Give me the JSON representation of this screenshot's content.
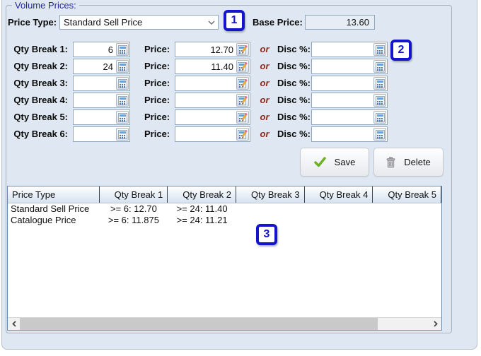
{
  "group": {
    "title": "Volume Prices:"
  },
  "header": {
    "price_type_label": "Price Type:",
    "price_type_value": "Standard Sell Price",
    "base_price_label": "Base Price:",
    "base_price_value": "13.60"
  },
  "callouts": {
    "one": "1",
    "two": "2",
    "three": "3"
  },
  "form": {
    "price_label": "Price:",
    "or_label": "or",
    "disc_label": "Disc %:",
    "rows": [
      {
        "label": "Qty Break 1:",
        "qty": "6",
        "price": "12.70",
        "disc": ""
      },
      {
        "label": "Qty Break 2:",
        "qty": "24",
        "price": "11.40",
        "disc": ""
      },
      {
        "label": "Qty Break 3:",
        "qty": "",
        "price": "",
        "disc": ""
      },
      {
        "label": "Qty Break 4:",
        "qty": "",
        "price": "",
        "disc": ""
      },
      {
        "label": "Qty Break 5:",
        "qty": "",
        "price": "",
        "disc": ""
      },
      {
        "label": "Qty Break 6:",
        "qty": "",
        "price": "",
        "disc": ""
      }
    ]
  },
  "buttons": {
    "save": "Save",
    "delete": "Delete"
  },
  "table": {
    "columns": [
      "Price Type",
      "Qty Break 1",
      "Qty Break 2",
      "Qty Break 3",
      "Qty Break 4",
      "Qty Break 5"
    ],
    "rows": [
      [
        "Standard Sell Price",
        ">= 6: 12.70",
        ">= 24: 11.40",
        "",
        "",
        ""
      ],
      [
        "Catalogue Price",
        ">= 6: 11.875",
        ">= 24: 11.21",
        "",
        "",
        ""
      ]
    ]
  },
  "icons": {
    "qty_field": "calculator-icon",
    "price_field": "calculator-edit-icon",
    "disc_field": "calculator-icon",
    "dropdown": "chevron-down-icon",
    "save": "check-icon",
    "delete": "trash-icon",
    "scroll_left": "chevron-left-icon",
    "scroll_right": "chevron-right-icon"
  },
  "colors": {
    "panel_bg": "#dfe8f2",
    "callout_blue": "#1414cc",
    "legend_navy": "#26269a",
    "or_red": "#8a2a22",
    "field_border": "#8fa6bd",
    "grid_border": "#6d8cae"
  }
}
